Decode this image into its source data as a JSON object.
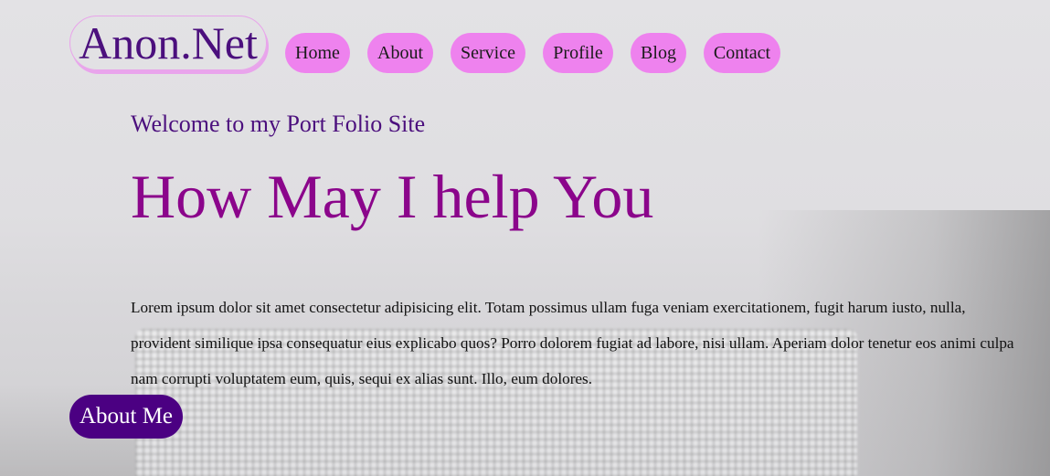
{
  "header": {
    "logo_text": "Anon.Net",
    "nav": [
      {
        "label": "Home"
      },
      {
        "label": "About"
      },
      {
        "label": "Service"
      },
      {
        "label": "Profile"
      },
      {
        "label": "Blog"
      },
      {
        "label": "Contact"
      }
    ]
  },
  "hero": {
    "welcome": "Welcome to my Port Folio Site",
    "headline": "How May I help You",
    "paragraph": "Lorem ipsum dolor sit amet consectetur adipisicing elit. Totam possimus ullam fuga veniam exercitationem, fugit harum iusto, nulla, provident similique ipsa consequatur eius explicabo quos? Porro dolorem fugiat ad labore, nisi ullam. Aperiam dolor tenetur eos animi culpa nam corrupti voluptatem eum, quis, sequi ex alias sunt. Illo, eum dolores.",
    "button_label": "About Me"
  },
  "colors": {
    "nav_button": "#ee82ee",
    "logo_text": "#4b0f7d",
    "headline": "#8b058b",
    "about_button": "#4b0082"
  }
}
